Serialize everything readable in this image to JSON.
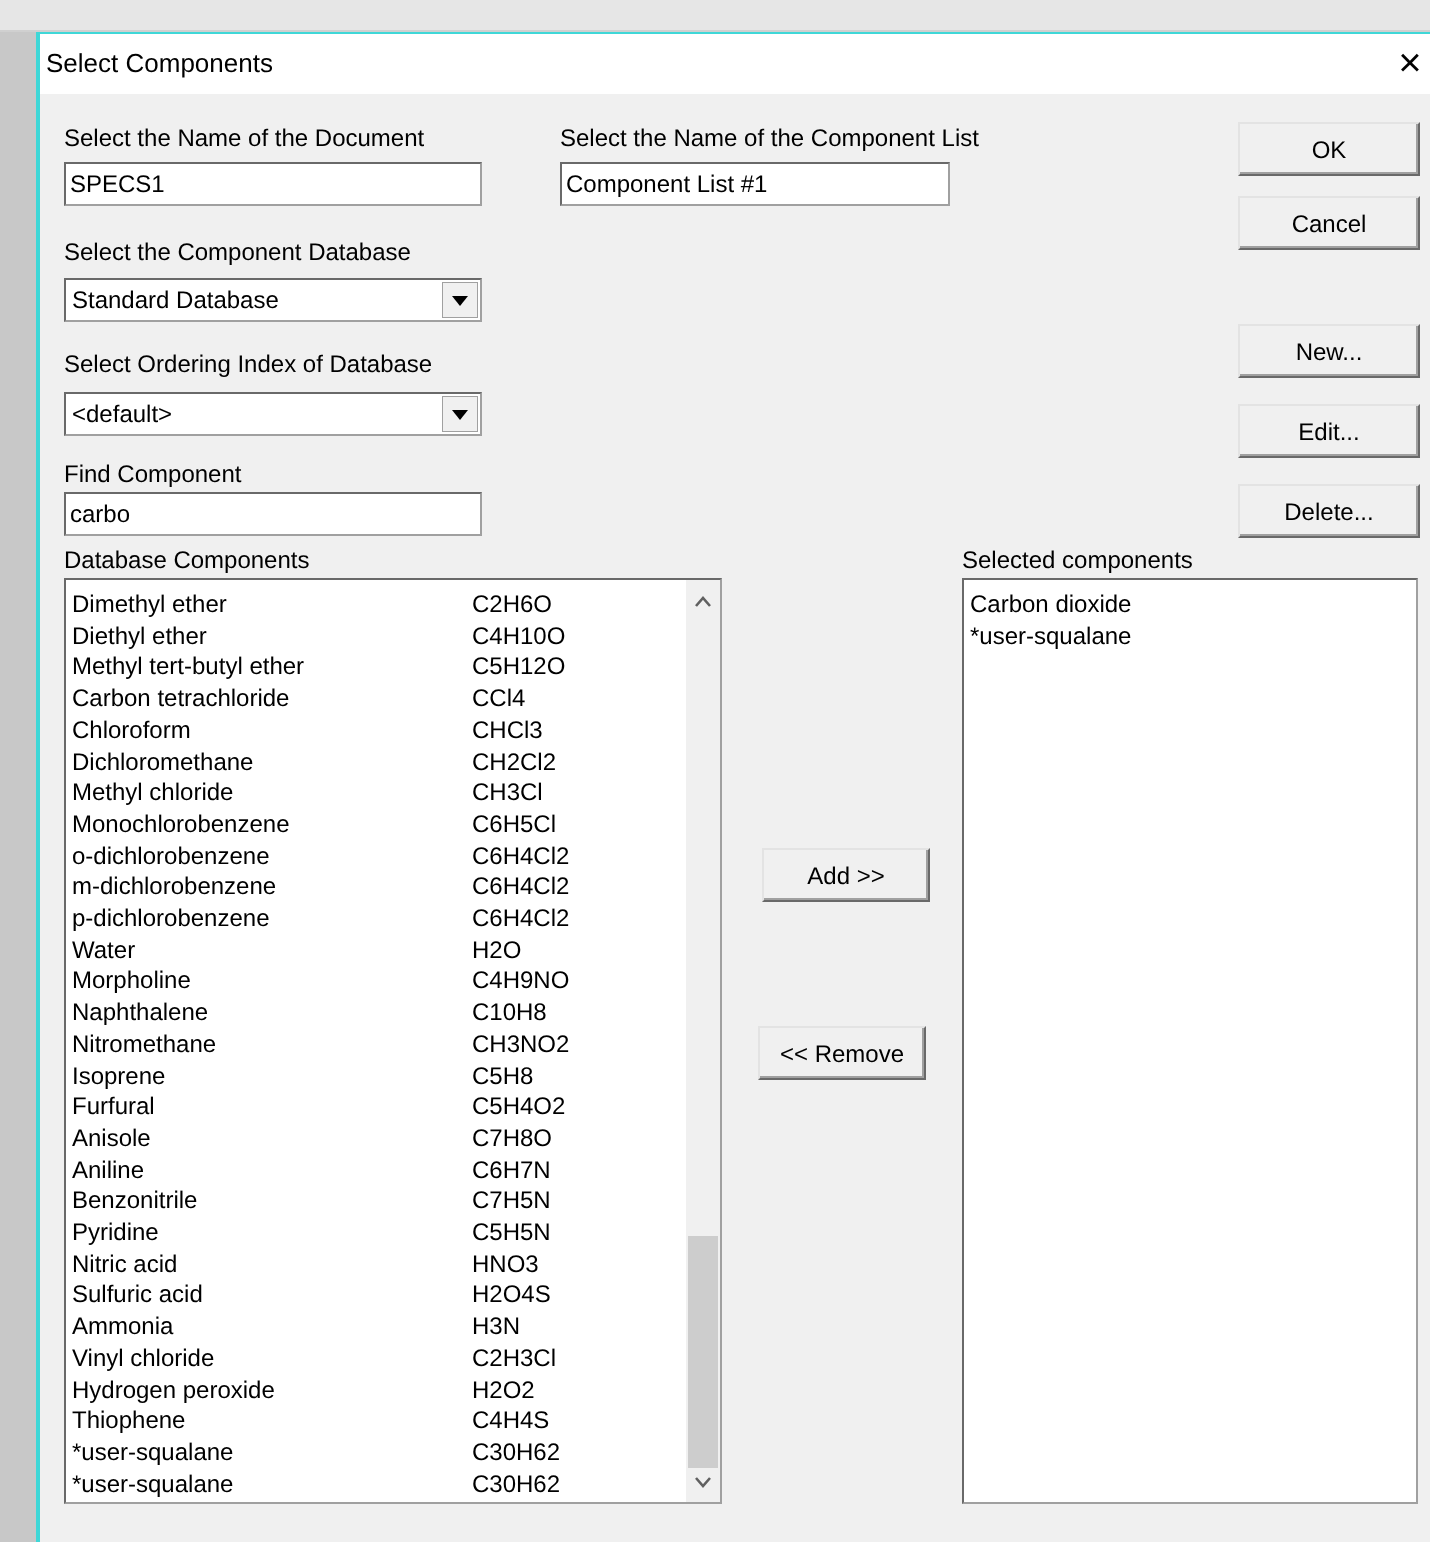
{
  "window": {
    "title": "Select Components",
    "close": "×"
  },
  "document": {
    "label": "Select the Name of the Document",
    "value": "SPECS1"
  },
  "component_list": {
    "label": "Select the Name of the Component List",
    "value": "Component List #1"
  },
  "database": {
    "label": "Select the Component Database",
    "value": "Standard Database"
  },
  "ordering": {
    "label": "Select Ordering Index of Database",
    "value": "<default>"
  },
  "find": {
    "label": "Find Component",
    "value": "carbo"
  },
  "buttons": [
    {
      "label": "OK",
      "kind": "ok"
    },
    {
      "label": "Cancel",
      "kind": "cancel"
    },
    {
      "label": "New...",
      "kind": "new"
    },
    {
      "label": "Edit...",
      "kind": "edit"
    },
    {
      "label": "Delete...",
      "kind": "delete"
    }
  ],
  "database_components": {
    "label": "Database Components",
    "rows": [
      {
        "name": "Dimethyl ether",
        "formula": "C2H6O"
      },
      {
        "name": "Diethyl ether",
        "formula": "C4H10O"
      },
      {
        "name": "Methyl tert-butyl ether",
        "formula": "C5H12O"
      },
      {
        "name": "Carbon tetrachloride",
        "formula": "CCl4"
      },
      {
        "name": "Chloroform",
        "formula": "CHCl3"
      },
      {
        "name": "Dichloromethane",
        "formula": "CH2Cl2"
      },
      {
        "name": "Methyl chloride",
        "formula": "CH3Cl"
      },
      {
        "name": "Monochlorobenzene",
        "formula": "C6H5Cl"
      },
      {
        "name": "o-dichlorobenzene",
        "formula": "C6H4Cl2"
      },
      {
        "name": "m-dichlorobenzene",
        "formula": "C6H4Cl2"
      },
      {
        "name": "p-dichlorobenzene",
        "formula": "C6H4Cl2"
      },
      {
        "name": "Water",
        "formula": "H2O"
      },
      {
        "name": "Morpholine",
        "formula": "C4H9NO"
      },
      {
        "name": "Naphthalene",
        "formula": "C10H8"
      },
      {
        "name": "Nitromethane",
        "formula": "CH3NO2"
      },
      {
        "name": "Isoprene",
        "formula": "C5H8"
      },
      {
        "name": "Furfural",
        "formula": "C5H4O2"
      },
      {
        "name": "Anisole",
        "formula": "C7H8O"
      },
      {
        "name": "Aniline",
        "formula": "C6H7N"
      },
      {
        "name": "Benzonitrile",
        "formula": "C7H5N"
      },
      {
        "name": "Pyridine",
        "formula": "C5H5N"
      },
      {
        "name": "Nitric acid",
        "formula": "HNO3"
      },
      {
        "name": "Sulfuric acid",
        "formula": "H2O4S"
      },
      {
        "name": "Ammonia",
        "formula": "H3N"
      },
      {
        "name": "Vinyl chloride",
        "formula": "C2H3Cl"
      },
      {
        "name": "Hydrogen peroxide",
        "formula": "H2O2"
      },
      {
        "name": "Thiophene",
        "formula": "C4H4S"
      },
      {
        "name": "*user-squalane",
        "formula": "C30H62"
      },
      {
        "name": "*user-squalane",
        "formula": "C30H62"
      }
    ]
  },
  "add_button": "Add >>",
  "remove_button": "<< Remove",
  "selected_components": {
    "label": "Selected components",
    "items": [
      "Carbon dioxide",
      "*user-squalane"
    ]
  }
}
